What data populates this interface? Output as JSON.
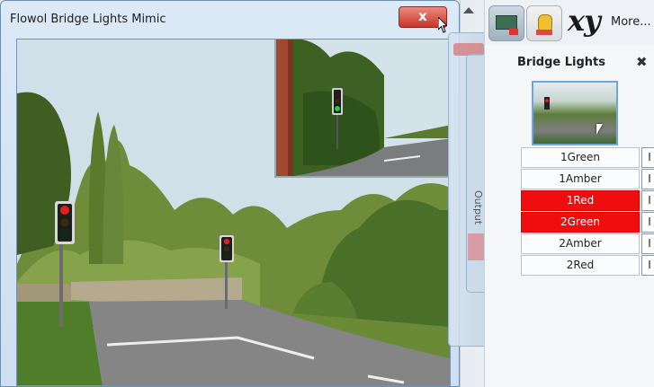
{
  "window": {
    "title": "Flowol Bridge Lights Mimic",
    "close_label": "x"
  },
  "toolbar": {
    "xy_label": "xy",
    "more_label": "More...",
    "icons": [
      "circuit-board-icon",
      "robot-icon"
    ]
  },
  "bridge_panel": {
    "title": "Bridge Lights",
    "pin_glyph": "✖",
    "signals": [
      {
        "label": "1Green",
        "state": "I",
        "on": false
      },
      {
        "label": "1Amber",
        "state": "I",
        "on": false
      },
      {
        "label": "1Red",
        "state": "I",
        "on": true
      },
      {
        "label": "2Green",
        "state": "I",
        "on": true
      },
      {
        "label": "2Amber",
        "state": "I",
        "on": false
      },
      {
        "label": "2Red",
        "state": "I",
        "on": false
      }
    ]
  },
  "background_panel": {
    "output_label": "Output"
  },
  "colors": {
    "active_signal": "#f00d0d",
    "red_light": "#e02020",
    "green_light": "#20d040",
    "close_button": "#c8352b"
  }
}
